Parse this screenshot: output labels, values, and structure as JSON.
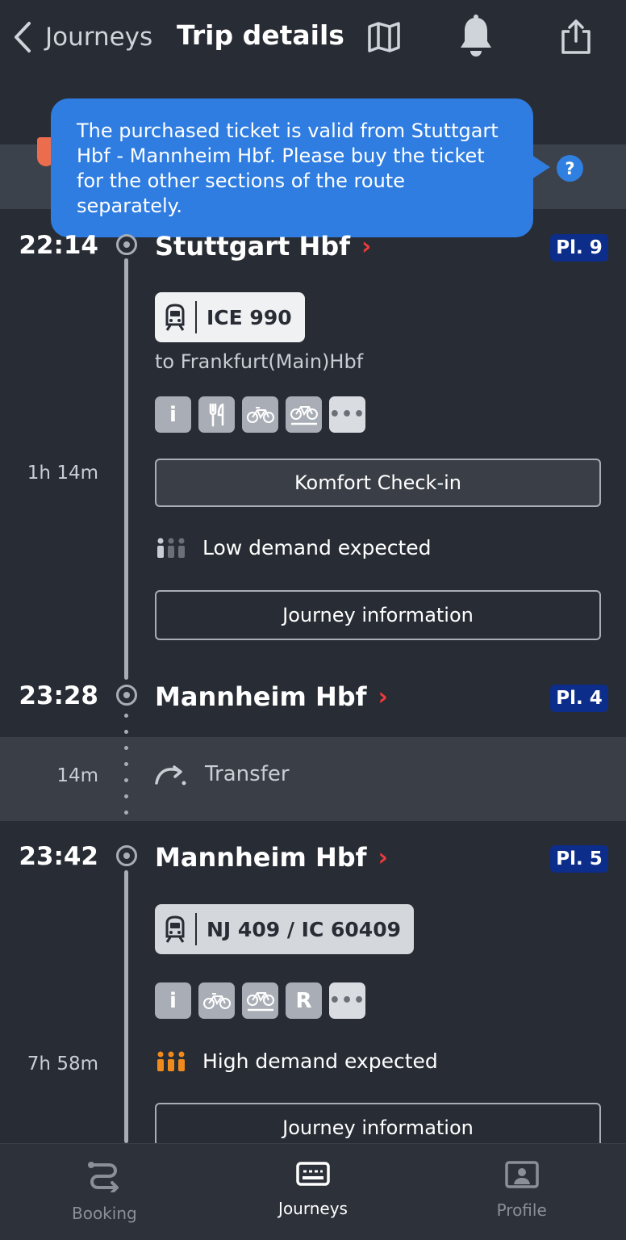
{
  "header": {
    "back_label": "Journeys",
    "title": "Trip details"
  },
  "tooltip": {
    "text": "The purchased ticket is valid from Stuttgart Hbf - Mannheim Hbf. Please buy the ticket for the other sections of the route separately.",
    "help": "?"
  },
  "leg1": {
    "departure_time": "22:14",
    "departure_station": "Stuttgart Hbf",
    "departure_platform": "Pl. 9",
    "train": "ICE 990",
    "destination": "to Frankfurt(Main)Hbf",
    "duration": "1h 14m",
    "checkin_label": "Komfort Check-in",
    "demand": "Low demand expected",
    "info_label": "Journey information",
    "arrival_time": "23:28",
    "arrival_station": "Mannheim Hbf",
    "arrival_platform": "Pl. 4"
  },
  "transfer": {
    "duration": "14m",
    "label": "Transfer"
  },
  "leg2": {
    "departure_time": "23:42",
    "departure_station": "Mannheim Hbf",
    "departure_platform": "Pl. 5",
    "train": "NJ 409 / IC 60409",
    "duration": "7h 58m",
    "demand": "High demand expected",
    "info_label": "Journey information",
    "reservation_letter": "R"
  },
  "nav": {
    "items": [
      {
        "label": "Booking"
      },
      {
        "label": "Journeys"
      },
      {
        "label": "Profile"
      }
    ]
  },
  "colors": {
    "background": "#282c34",
    "tooltip": "#2f7de1",
    "platform": "#0d2d8a",
    "accent_red": "#ec3b3b",
    "high_demand": "#f08a1c"
  }
}
